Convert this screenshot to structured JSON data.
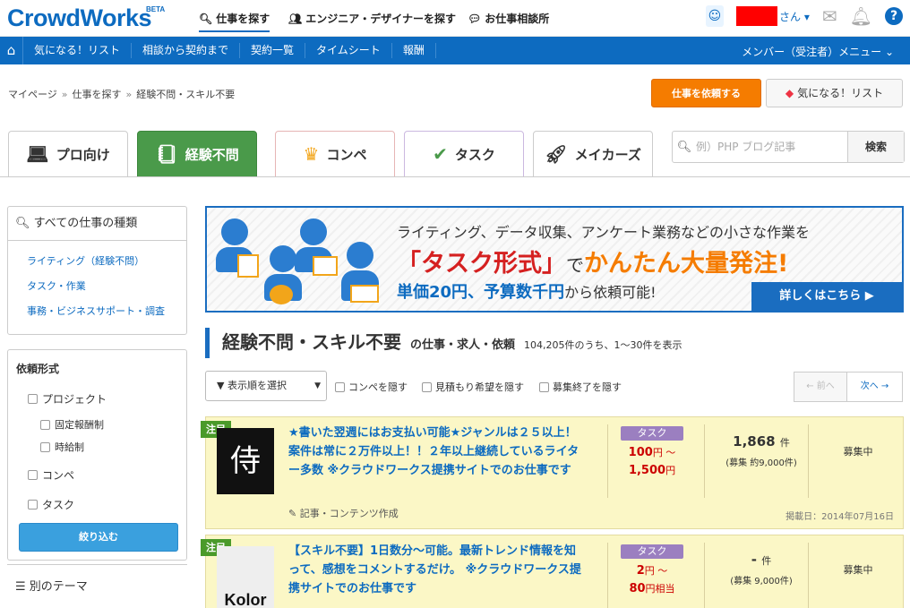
{
  "header": {
    "logo": "CrowdWorks",
    "beta": "BETA",
    "nav": [
      {
        "label": "仕事を探す"
      },
      {
        "label": "エンジニア・デザイナーを探す"
      },
      {
        "label": "お仕事相談所"
      }
    ],
    "user_suffix": "さん"
  },
  "subnav": {
    "items": [
      "気になる！リスト",
      "相談から契約まで",
      "契約一覧",
      "タイムシート",
      "報酬"
    ],
    "member_menu": "メンバー（受注者）メニュー"
  },
  "breadcrumb": [
    "マイページ",
    "仕事を探す",
    "経験不問・スキル不要"
  ],
  "breadcrumb_sep": "»",
  "buttons": {
    "request": "仕事を依頼する",
    "favorites": "気になる！リスト"
  },
  "tabs": [
    {
      "label": "プロ向け",
      "color": "#f3f8fd",
      "icon": "laptop-icon"
    },
    {
      "label": "経験不問",
      "color": "#4a9a4a",
      "icon": "notebook-icon"
    },
    {
      "label": "コンペ",
      "color": "#fdf3f3",
      "icon": "crown-icon"
    },
    {
      "label": "タスク",
      "color": "#f6f2fb",
      "icon": "checklist-icon"
    },
    {
      "label": "メイカーズ",
      "color": "#f2f2f2",
      "icon": "rocket-icon"
    }
  ],
  "search": {
    "placeholder": "例）PHP ブログ記事",
    "button": "検索"
  },
  "sidebar": {
    "categories_header": "すべての仕事の種類",
    "categories": [
      "ライティング（経験不問）",
      "タスク・作業",
      "事務・ビジネスサポート・調査"
    ],
    "filter_header": "依頼形式",
    "filters": [
      "プロジェクト",
      "固定報酬制",
      "時給制",
      "コンペ",
      "タスク"
    ],
    "filter_button": "絞り込む",
    "theme": "別のテーマ"
  },
  "banner": {
    "line1": "ライティング、データ収集、アンケート業務などの小さな作業を",
    "line2_quoted": "「タスク形式」",
    "line2_de": "で",
    "line2_rest": "かんたん大量発注!",
    "line3_bold": "単価20円、予算数千円",
    "line3_rest": "から依頼可能!",
    "more": "詳しくはこちら ▶"
  },
  "page": {
    "title": "経験不問・スキル不要",
    "subtitle": "の仕事・求人・依頼",
    "count": "104,205件のうち、1〜30件を表示"
  },
  "controls": {
    "sort": "▼ 表示順を選択",
    "options": [
      "コンペを隠す",
      "見積もり希望を隠す",
      "募集終了を隠す"
    ],
    "prev": "← 前へ",
    "next": "次へ →"
  },
  "jobs": [
    {
      "ribbon": "注目",
      "thumb": "侍",
      "title": "★書いた翌週にはお支払い可能★ジャンルは２５以上！案件は常に２万件以上！！２年以上継続しているライター多数 ※クラウドワークス提携サイトでのお仕事です",
      "badge": "タスク",
      "price_low": "100",
      "price_unit1": "円 〜",
      "price_high": "1,500",
      "price_unit2": "円",
      "count": "1,868",
      "count_unit": "件",
      "sub": "(募集 約9,000件)",
      "status": "募集中",
      "category": "✎ 記事・コンテンツ作成",
      "date": "掲載日：2014年07月16日"
    },
    {
      "ribbon": "注目",
      "thumb": "Kolor",
      "title": "【スキル不要】1日数分〜可能。最新トレンド情報を知って、感想をコメントするだけ。 ※クラウドワークス提携サイトでのお仕事です",
      "badge": "タスク",
      "price_low": "2",
      "price_unit1": "円 〜",
      "price_high": "80",
      "price_unit2": "円相当",
      "count": "-",
      "count_unit": "件",
      "sub": "(募集 9,000件)",
      "status": "募集中",
      "category": "",
      "date": ""
    }
  ]
}
